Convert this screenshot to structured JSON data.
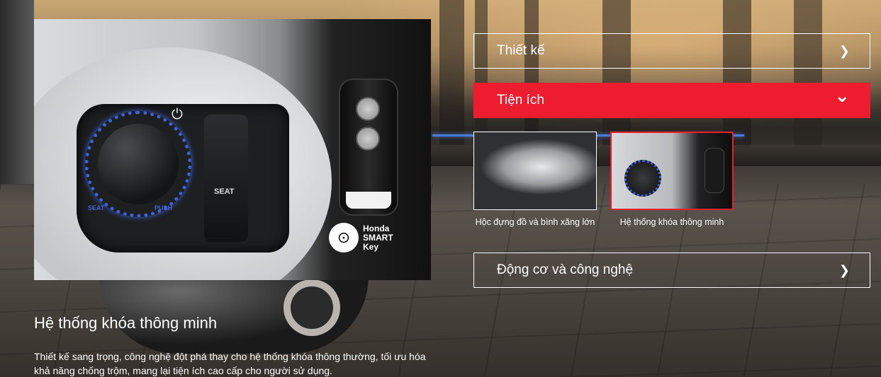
{
  "photo": {
    "power_glyph": "⏻",
    "seat_label": "SEAT",
    "seat_small": "SEAT",
    "push_small": "PUSH",
    "brand_lines": [
      "Honda",
      "SMART",
      "Key"
    ]
  },
  "caption": {
    "title": "Hệ thống khóa thông minh",
    "text": "Thiết kế sang trọng, công nghệ đột phá thay cho hệ thống khóa thông thường, tối ưu hóa khả năng chống trộm, mang lại tiện ích cao cấp cho người sử dụng."
  },
  "accordion": [
    {
      "label": "Thiết kế",
      "icon": "chevron-right-icon",
      "glyph": "❯",
      "expanded": false
    },
    {
      "label": "Tiện ích",
      "icon": "chevron-down-icon",
      "glyph": "⌄",
      "expanded": true
    },
    {
      "label": "Động cơ và công nghệ",
      "icon": "chevron-right-icon",
      "glyph": "❯",
      "expanded": false
    }
  ],
  "thumbnails": [
    {
      "label": "Hộc đựng đồ và bình xăng lớn",
      "selected": false
    },
    {
      "label": "Hệ thống khóa thông minh",
      "selected": true
    }
  ],
  "colors": {
    "accent": "#ed1c2e",
    "knob_ring": "#3f63d6"
  }
}
